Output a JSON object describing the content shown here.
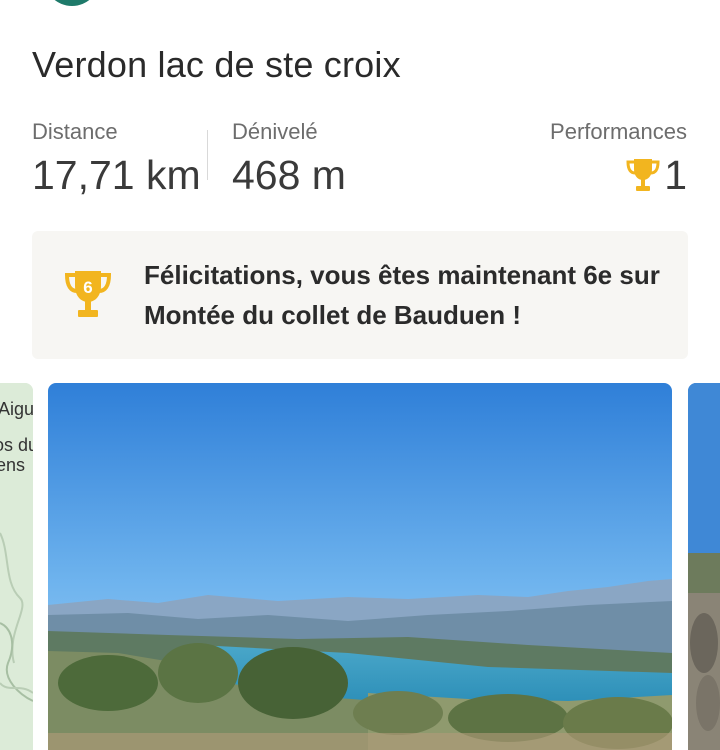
{
  "activity": {
    "title": "Verdon lac de ste croix"
  },
  "stats": {
    "distance_label": "Distance",
    "distance_value": "17,71 km",
    "elevation_label": "Dénivelé",
    "elevation_value": "468 m",
    "performances_label": "Performances",
    "performances_value": "1"
  },
  "achievement": {
    "rank": "6",
    "message": "Félicitations, vous êtes maintenant 6e sur Montée du collet de Bauduen !"
  },
  "map_preview": {
    "label_1": "Aigu",
    "label_2": "os du",
    "label_3": "ens"
  },
  "colors": {
    "trophy_gold": "#f2b51f",
    "banner_bg": "#f7f6f3",
    "avatar": "#1e7a6a"
  }
}
